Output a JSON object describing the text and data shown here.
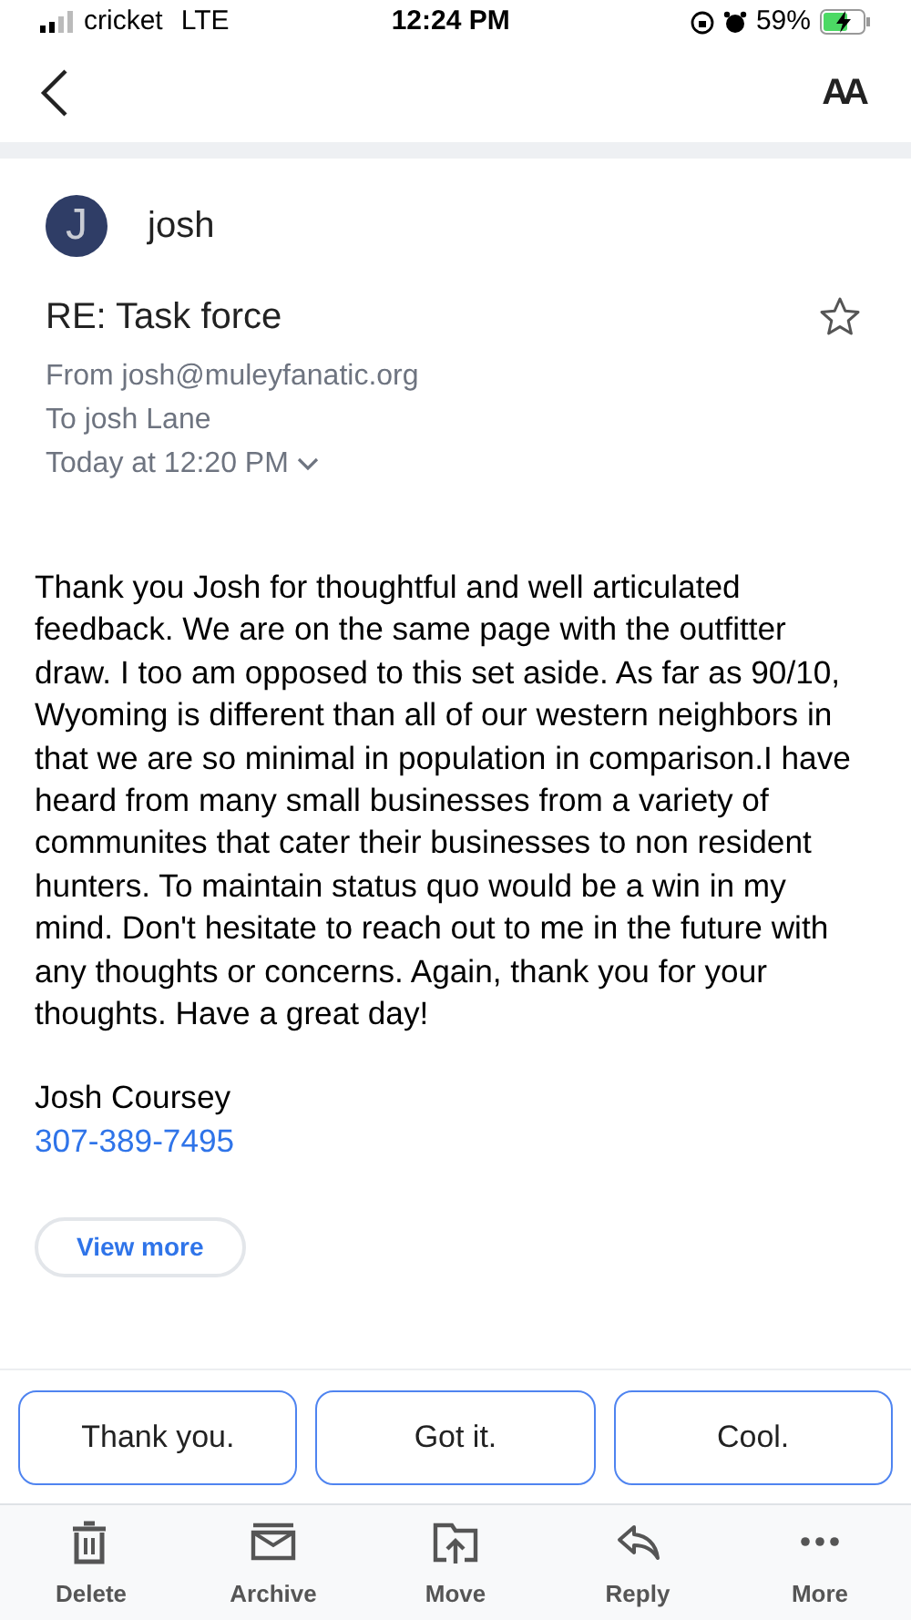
{
  "status_bar": {
    "carrier": "cricket",
    "network": "LTE",
    "time": "12:24 PM",
    "battery": "59%"
  },
  "header": {
    "font_size_label": "AA"
  },
  "message": {
    "avatar_letter": "J",
    "sender": "josh",
    "subject": "RE: Task force",
    "starred": false,
    "from": "From josh@muleyfanatic.org",
    "to": "To josh Lane",
    "date": "Today at 12:20 PM",
    "body": "Thank you Josh for thoughtful and well articulated feedback. We are on the same page with the outfitter draw. I too am opposed to this set aside. As far as 90/10, Wyoming is different than all of our western neighbors in that we are so minimal in population in comparison.I have heard from many small businesses from a variety of communites that cater their businesses to non resident hunters. To maintain status quo would be a win in my mind. Don't hesitate to reach out to me in the future with any thoughts or concerns. Again, thank you for your thoughts. Have a great day!",
    "signature": "Josh Coursey",
    "phone": "307-389-7495",
    "view_more": "View more"
  },
  "quick_replies": [
    "Thank you.",
    "Got it.",
    "Cool."
  ],
  "toolbar": [
    {
      "kind": "delete",
      "label": "Delete"
    },
    {
      "kind": "archive",
      "label": "Archive"
    },
    {
      "kind": "move",
      "label": "Move"
    },
    {
      "kind": "reply",
      "label": "Reply"
    },
    {
      "kind": "more",
      "label": "More"
    }
  ]
}
